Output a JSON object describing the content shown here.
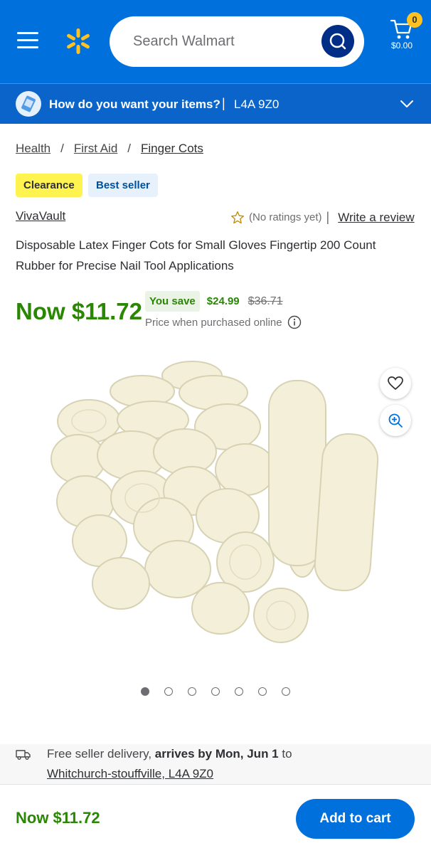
{
  "header": {
    "search_placeholder": "Search Walmart",
    "cart_count": "0",
    "cart_total": "$0.00"
  },
  "delivery": {
    "question": "How do you want your items?",
    "separator": "|",
    "postal": "L4A 9Z0"
  },
  "breadcrumb": {
    "items": [
      "Health",
      "First Aid",
      "Finger Cots"
    ],
    "sep": "/"
  },
  "badges": {
    "clearance": "Clearance",
    "best_seller": "Best seller"
  },
  "product": {
    "brand": "VivaVault",
    "ratings": "(No ratings yet)",
    "ratings_sep": "|",
    "write_review": "Write a review",
    "title": "Disposable Latex Finger Cots for Small Gloves Fingertip 200 Count Rubber for Precise Nail Tool Applications",
    "price": "Now $11.72",
    "you_save_label": "You save",
    "you_save_amount": "$24.99",
    "was_price": "$36.71",
    "price_note": "Price when purchased online"
  },
  "gallery": {
    "active_index": 0,
    "total": 7
  },
  "shipping": {
    "prefix": "Free seller delivery, ",
    "arrives": "arrives by Mon, Jun 1",
    "suffix": " to",
    "location": "Whitchurch-stouffville, L4A 9Z0"
  },
  "footer": {
    "price": "Now $11.72",
    "add_to_cart": "Add to cart"
  },
  "colors": {
    "brand_blue": "#0071dc",
    "spark_yellow": "#ffc220",
    "price_green": "#2a8703"
  }
}
